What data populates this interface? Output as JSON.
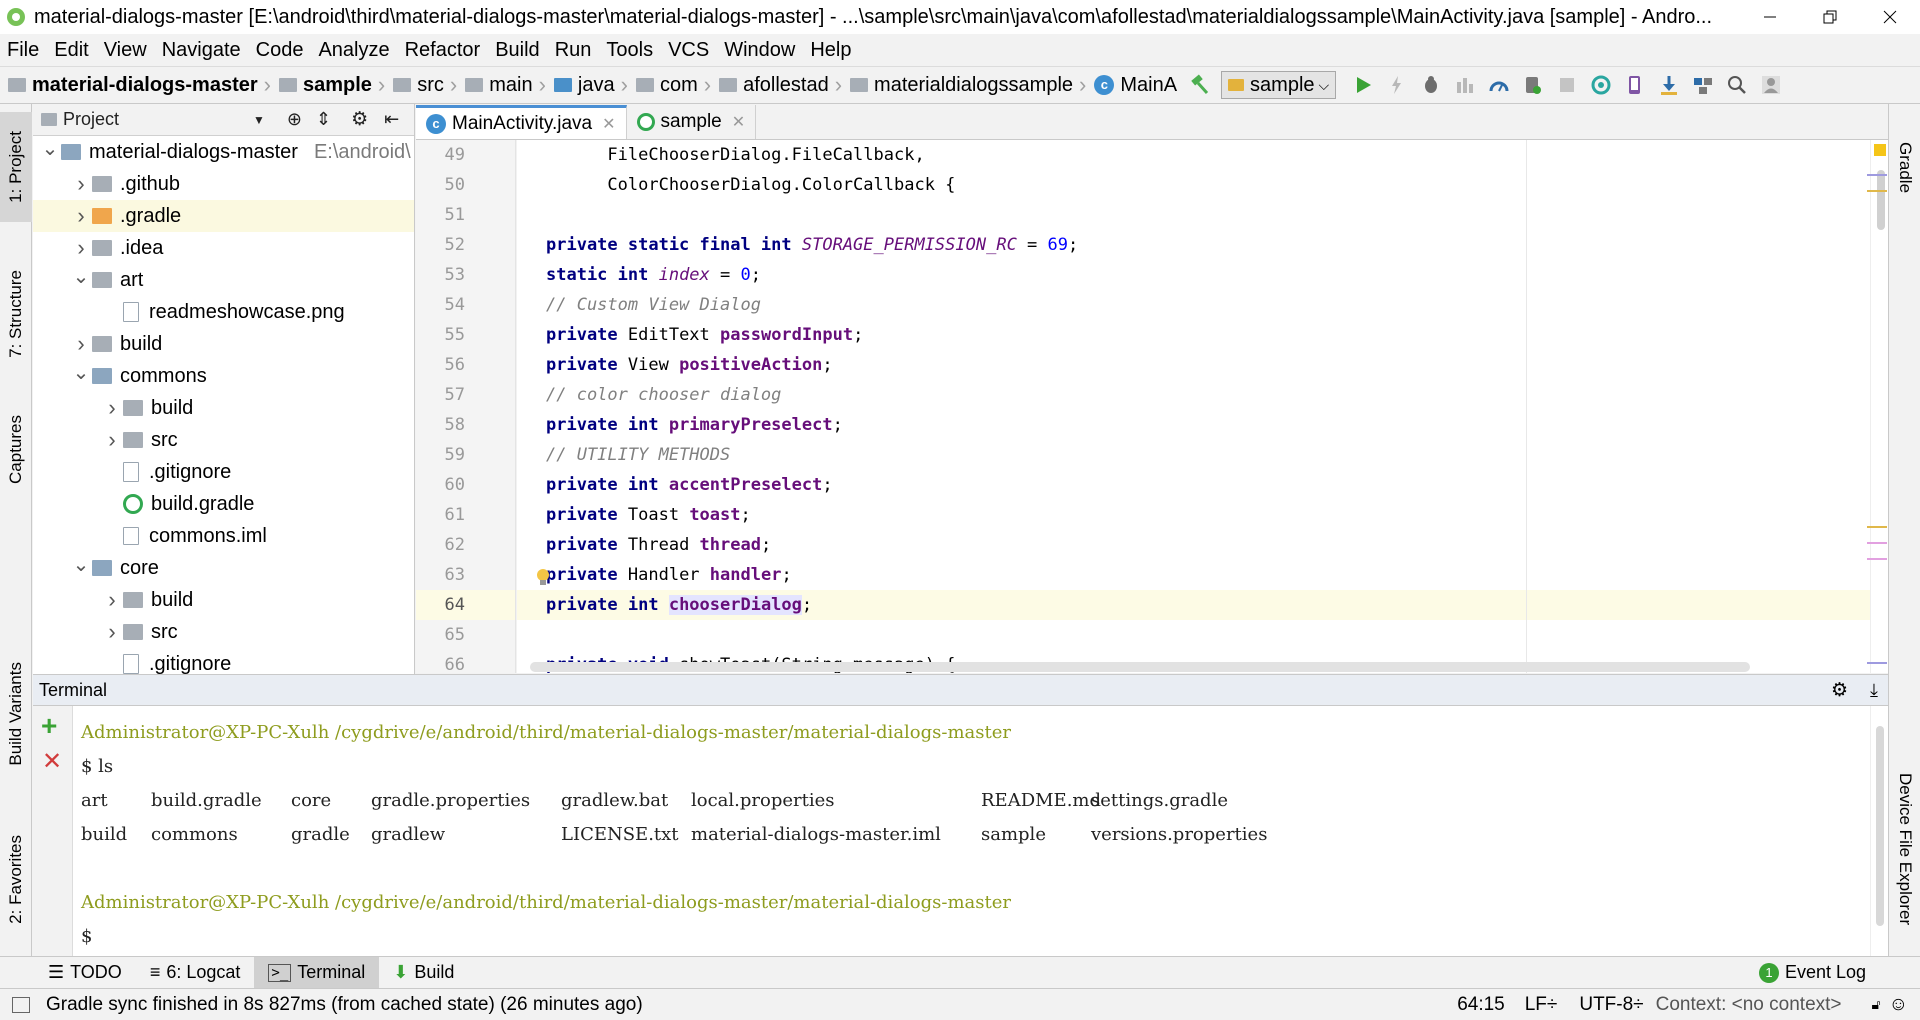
{
  "window": {
    "title": "material-dialogs-master [E:\\android\\third\\material-dialogs-master\\material-dialogs-master] - ...\\sample\\src\\main\\java\\com\\afollestad\\materialdialogssample\\MainActivity.java [sample] - Andro..."
  },
  "menu": [
    "File",
    "Edit",
    "View",
    "Navigate",
    "Code",
    "Analyze",
    "Refactor",
    "Build",
    "Run",
    "Tools",
    "VCS",
    "Window",
    "Help"
  ],
  "breadcrumbs": [
    "material-dialogs-master",
    "sample",
    "src",
    "main",
    "java",
    "com",
    "afollestad",
    "materialdialogssample",
    "MainA"
  ],
  "toolbar": {
    "run_config": "sample"
  },
  "left_tool_tabs": [
    "1: Project",
    "7: Structure",
    "Captures",
    "Build Variants",
    "2: Favorites"
  ],
  "right_tool_tabs": [
    "Gradle",
    "Device File Explorer"
  ],
  "project_panel": {
    "header": "Project",
    "tree": [
      {
        "label": "material-dialogs-master",
        "sub": "E:\\android\\",
        "indent": 0,
        "arrow": "down",
        "icon": "module"
      },
      {
        "label": ".github",
        "indent": 1,
        "arrow": "right",
        "icon": "folder"
      },
      {
        "label": ".gradle",
        "indent": 1,
        "arrow": "right",
        "icon": "folder-orange",
        "selected": true
      },
      {
        "label": ".idea",
        "indent": 1,
        "arrow": "right",
        "icon": "folder"
      },
      {
        "label": "art",
        "indent": 1,
        "arrow": "down",
        "icon": "folder"
      },
      {
        "label": "readmeshowcase.png",
        "indent": 2,
        "arrow": "",
        "icon": "file"
      },
      {
        "label": "build",
        "indent": 1,
        "arrow": "right",
        "icon": "folder"
      },
      {
        "label": "commons",
        "indent": 1,
        "arrow": "down",
        "icon": "module"
      },
      {
        "label": "build",
        "indent": 2,
        "arrow": "right",
        "icon": "folder"
      },
      {
        "label": "src",
        "indent": 2,
        "arrow": "right",
        "icon": "folder"
      },
      {
        "label": ".gitignore",
        "indent": 2,
        "arrow": "",
        "icon": "file"
      },
      {
        "label": "build.gradle",
        "indent": 2,
        "arrow": "",
        "icon": "gradle"
      },
      {
        "label": "commons.iml",
        "indent": 2,
        "arrow": "",
        "icon": "iml"
      },
      {
        "label": "core",
        "indent": 1,
        "arrow": "down",
        "icon": "module"
      },
      {
        "label": "build",
        "indent": 2,
        "arrow": "right",
        "icon": "folder"
      },
      {
        "label": "src",
        "indent": 2,
        "arrow": "right",
        "icon": "folder"
      },
      {
        "label": ".gitignore",
        "indent": 2,
        "arrow": "",
        "icon": "file"
      }
    ]
  },
  "editor_tabs": [
    {
      "label": "MainActivity.java",
      "icon": "class-icon",
      "active": true
    },
    {
      "label": "sample",
      "icon": "gradle-icon",
      "active": false
    }
  ],
  "code": {
    "line_numbers": [
      "49",
      "50",
      "51",
      "52",
      "53",
      "54",
      "55",
      "56",
      "57",
      "58",
      "59",
      "60",
      "61",
      "62",
      "63",
      "64",
      "65",
      "66"
    ],
    "current_line": "64"
  },
  "terminal": {
    "title": "Terminal",
    "prompt_user": "Administrator@XP-PC-Xulh",
    "prompt_path": "/cygdrive/e/android/third/material-dialogs-master/material-dialogs-master",
    "command": "$ ls",
    "ls_rows": [
      [
        "art",
        "build.gradle",
        "core",
        "gradle.properties",
        "gradlew.bat",
        "local.properties",
        "README.md",
        "settings.gradle"
      ],
      [
        "build",
        "commons",
        "gradle",
        "gradlew",
        "LICENSE.txt",
        "material-dialogs-master.iml",
        "sample",
        "versions.properties"
      ]
    ],
    "last_prompt": "$"
  },
  "bottom_tabs": [
    {
      "label": "TODO",
      "active": false
    },
    {
      "label": "6: Logcat",
      "active": false
    },
    {
      "label": "Terminal",
      "active": true
    },
    {
      "label": "Build",
      "active": false
    }
  ],
  "event_log": {
    "count": "1",
    "label": "Event Log"
  },
  "status": {
    "message": "Gradle sync finished in 8s 827ms (from cached state) (26 minutes ago)",
    "position": "64:15",
    "line_sep": "LF÷",
    "encoding": "UTF-8÷",
    "context": "Context: <no context>"
  },
  "colors": {
    "keyword": "#000080",
    "field": "#660e7a",
    "number": "#0000ff",
    "comment": "#808080",
    "prompt": "#8e9c1e",
    "current_line": "#fdfbe5"
  }
}
